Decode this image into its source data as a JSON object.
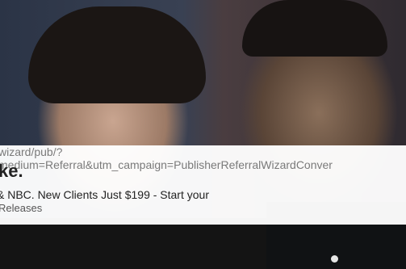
{
  "ad": {
    "url_line_1": "wizard/pub/?",
    "url_line_2": "medium=Referral&utm_campaign=PublisherReferralWizardConver",
    "headline": "ke.",
    "description": "& NBC. New Clients Just $199 - Start your",
    "source": "Releases"
  }
}
